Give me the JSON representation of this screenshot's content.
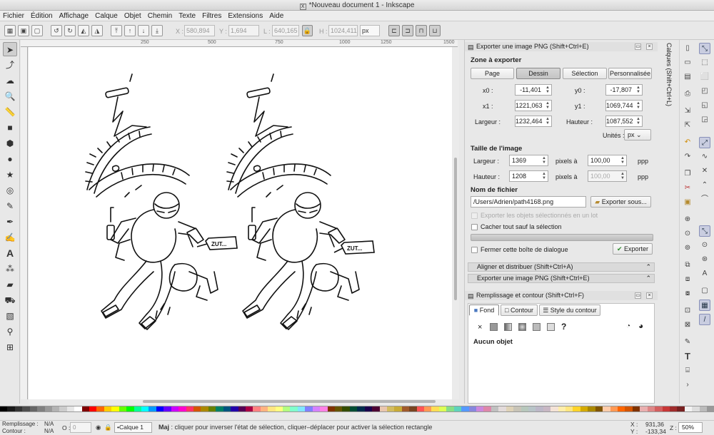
{
  "window": {
    "title": "*Nouveau document 1 - Inkscape"
  },
  "menu": [
    "Fichier",
    "Édition",
    "Affichage",
    "Calque",
    "Objet",
    "Chemin",
    "Texte",
    "Filtres",
    "Extensions",
    "Aide"
  ],
  "controls": {
    "x_label": "X :",
    "x_value": "580,894",
    "y_label": "Y :",
    "y_value": "1,694",
    "w_label": "L :",
    "w_value": "640,165",
    "h_label": "H :",
    "h_value": "1024,411",
    "unit": "px"
  },
  "ruler": {
    "ticks": [
      "250",
      "500",
      "750",
      "1000",
      "1250",
      "1500"
    ]
  },
  "canvas": {
    "speech_left": "ZUT...",
    "speech_right": "ZUT..."
  },
  "export_panel": {
    "title": "Exporter une image PNG (Shift+Ctrl+E)",
    "zone_label": "Zone à exporter",
    "zone_buttons": [
      "Page",
      "Dessin",
      "Sélection",
      "Personnalisée"
    ],
    "x0_label": "x0 :",
    "x0": "-11,401",
    "y0_label": "y0 :",
    "y0": "-17,807",
    "x1_label": "x1 :",
    "x1": "1221,063",
    "y1_label": "y1 :",
    "y1": "1069,744",
    "width_label": "Largeur :",
    "width": "1232,464",
    "height_label": "Hauteur :",
    "height": "1087,552",
    "units_label": "Unités :",
    "units": "px",
    "image_size_label": "Taille de l'image",
    "img_width_label": "Largeur :",
    "img_width": "1369",
    "img_width_unit": "pixels à",
    "dpi_x": "100,00",
    "dpi_unit_x": "ppp",
    "img_height_label": "Hauteur :",
    "img_height": "1208",
    "img_height_unit": "pixels à",
    "dpi_y": "100,00",
    "dpi_unit_y": "ppp",
    "filename_label": "Nom de fichier",
    "filename": "/Users/Adrien/path4168.png",
    "export_as": "Exporter sous...",
    "opt_selected": "Exporter les objets sélectionnés en un lot",
    "opt_hide": "Cacher tout sauf la sélection",
    "opt_close": "Fermer cette boîte de dialogue",
    "export_button": "Exporter"
  },
  "collapsed_panels": [
    "Aligner et distribuer (Shift+Ctrl+A)",
    "Exporter une image PNG (Shift+Ctrl+E)"
  ],
  "fill_panel": {
    "title": "Remplissage et contour (Shift+Ctrl+F)",
    "tabs": [
      "Fond",
      "Contour",
      "Style du contour"
    ],
    "unknown_symbol": "?",
    "no_object": "Aucun objet"
  },
  "layers_tab": "Calques (Shift+Ctrl+L)",
  "palette": [
    "#000000",
    "#1a1a1a",
    "#333333",
    "#4d4d4d",
    "#666666",
    "#808080",
    "#999999",
    "#b3b3b3",
    "#cccccc",
    "#e6e6e6",
    "#ffffff",
    "#800000",
    "#ff0000",
    "#ff6600",
    "#ffcc00",
    "#ffff00",
    "#66ff00",
    "#00ff00",
    "#00ff99",
    "#00ffff",
    "#0099ff",
    "#0000ff",
    "#6600ff",
    "#cc00ff",
    "#ff00cc",
    "#ff3366",
    "#d45500",
    "#aa8800",
    "#668000",
    "#008066",
    "#005580",
    "#2200aa",
    "#550055",
    "#aa0044",
    "#ff8080",
    "#ffb380",
    "#ffe680",
    "#ffff80",
    "#b3ff80",
    "#80ffcc",
    "#80e5ff",
    "#8080ff",
    "#d580ff",
    "#ff80e5",
    "#803300",
    "#665500",
    "#334d00",
    "#004d33",
    "#002b4d",
    "#1a004d",
    "#4d0033",
    "#e9c6af",
    "#d3bc5f",
    "#c8ab37",
    "#a05a2c",
    "#784421",
    "#ff5555",
    "#ff9955",
    "#ffdd55",
    "#ddff55",
    "#87de87",
    "#5fd3bc",
    "#5599ff",
    "#8787de",
    "#cc88dd",
    "#de87aa",
    "#c0c0c0",
    "#e3dbdb",
    "#ded2b7",
    "#c8c4b7",
    "#b7c8bc",
    "#b7c4c8",
    "#bcb7c8",
    "#c8b7c4",
    "#f4e3d7",
    "#ffeeaa",
    "#ffe680",
    "#ffd42a",
    "#d4aa00",
    "#aa8800",
    "#805500",
    "#ffccaa",
    "#ff9955",
    "#ff6600",
    "#d45500",
    "#803300",
    "#e9afaf",
    "#de8787",
    "#d35f5f",
    "#c83737",
    "#a02c2c",
    "#782121",
    "#f2f2f2",
    "#dddddd",
    "#bbbbbb",
    "#999999"
  ],
  "status": {
    "fill_label": "Remplissage :",
    "fill_value": "N/A",
    "stroke_label": "Contour :",
    "stroke_value": "N/A",
    "opacity_label": "O :",
    "opacity_value": "0",
    "layer": "•Calque 1",
    "message_bold": "Maj",
    "message": " : cliquer pour inverser l'état de sélection, cliquer–déplacer pour activer la sélection rectangle",
    "x_label": "X :",
    "x": "931,36",
    "y_label": "Y :",
    "y": "-133,34",
    "zoom_label": "Z :",
    "zoom": "50%"
  }
}
